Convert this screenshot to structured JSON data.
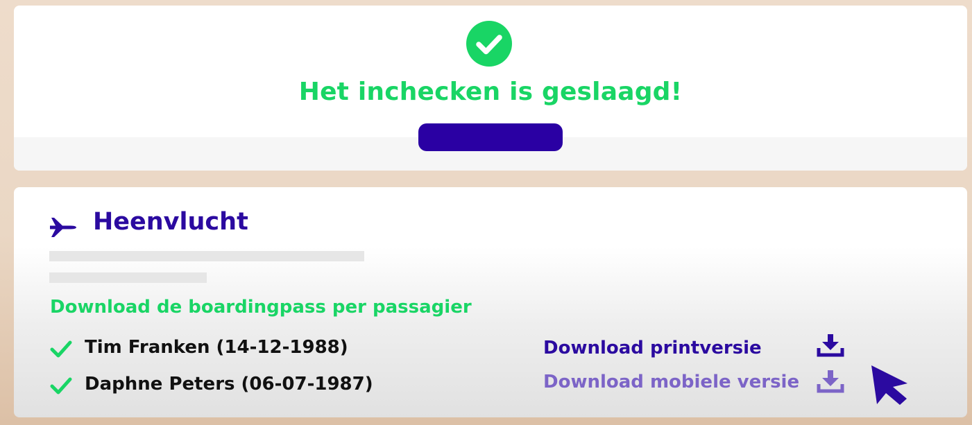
{
  "success": {
    "title": "Het inchecken is geslaagd!",
    "icon": "check-circle-icon",
    "color": "#19d565"
  },
  "flight": {
    "title": "Heenvlucht",
    "icon": "airplane-icon",
    "download_heading": "Download de boardingpass per passagier",
    "passengers": [
      {
        "name": "Tim Franken (14-12-1988)"
      },
      {
        "name": "Daphne Peters (06-07-1987)"
      }
    ],
    "downloads": {
      "print_label": "Download printversie",
      "mobile_label": "Download mobiele versie",
      "icon": "download-icon"
    }
  },
  "colors": {
    "accent_green": "#19d565",
    "brand_indigo": "#2b0aa0",
    "button_indigo": "#2a00a3",
    "muted_purple": "#7c64c7"
  }
}
